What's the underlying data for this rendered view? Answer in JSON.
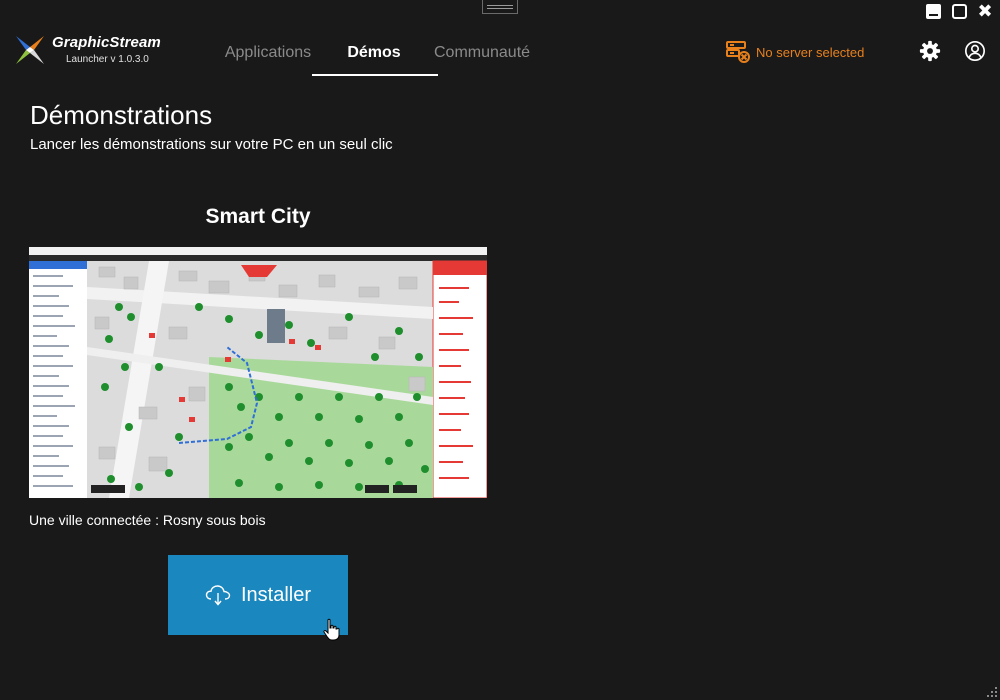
{
  "app": {
    "name": "GraphicStream",
    "version": "Launcher v 1.0.3.0",
    "logo_icon": "graphicstream-logo"
  },
  "window_controls": {
    "minimize_icon": "minimize-icon",
    "maximize_icon": "maximize-icon",
    "close_icon": "close-icon",
    "close_glyph": "✖"
  },
  "nav": {
    "tabs": [
      {
        "label": "Applications",
        "active": false
      },
      {
        "label": "Démos",
        "active": true
      },
      {
        "label": "Communauté",
        "active": false
      }
    ]
  },
  "server": {
    "status": "No server selected",
    "icon": "server-error-icon",
    "color": "#e8801c"
  },
  "header_icons": {
    "settings": "gear-icon",
    "account": "user-icon"
  },
  "page": {
    "title": "Démonstrations",
    "subtitle": "Lancer les démonstrations sur votre PC en un seul clic"
  },
  "demo": {
    "title": "Smart City",
    "description": "Une ville connectée : Rosny sous bois",
    "thumbnail": "smart-city-3d-map-screenshot",
    "install_label": "Installer",
    "install_icon": "cloud-download-icon",
    "install_color": "#1a87bf"
  }
}
